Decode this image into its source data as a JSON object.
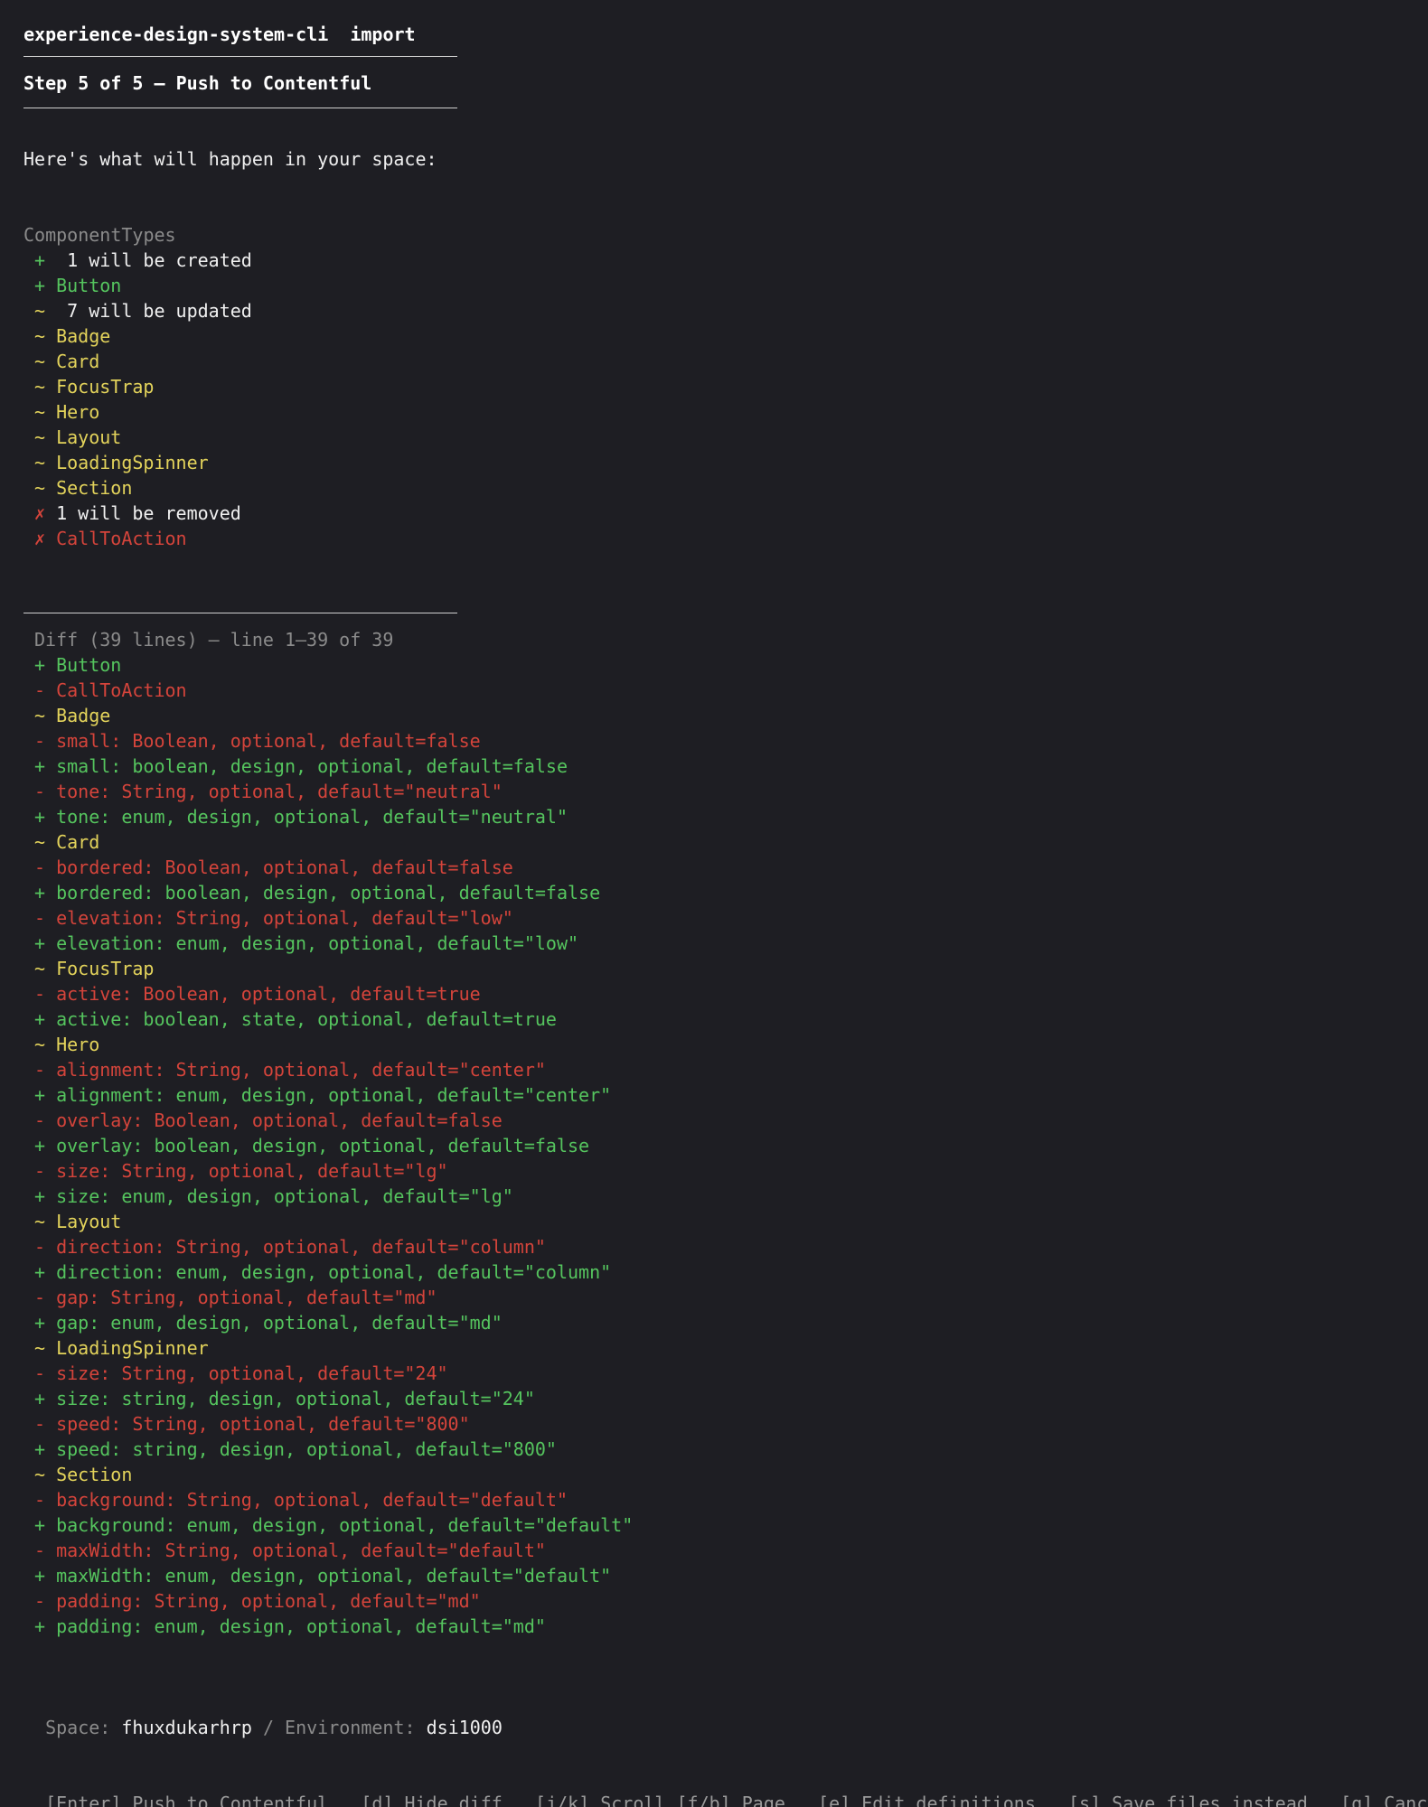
{
  "window": {
    "command": "experience-design-system-cli",
    "subcommand": "import"
  },
  "step": {
    "label": "Step 5 of 5 — Push to Contentful"
  },
  "intro": "Here's what will happen in your space:",
  "summary": {
    "heading": "ComponentTypes",
    "lines": [
      {
        "marker": "+",
        "text": " 1 will be created",
        "kind": "count-create"
      },
      {
        "marker": "+",
        "text": "Button",
        "kind": "create"
      },
      {
        "marker": "~",
        "text": " 7 will be updated",
        "kind": "count-update"
      },
      {
        "marker": "~",
        "text": "Badge",
        "kind": "update"
      },
      {
        "marker": "~",
        "text": "Card",
        "kind": "update"
      },
      {
        "marker": "~",
        "text": "FocusTrap",
        "kind": "update"
      },
      {
        "marker": "~",
        "text": "Hero",
        "kind": "update"
      },
      {
        "marker": "~",
        "text": "Layout",
        "kind": "update"
      },
      {
        "marker": "~",
        "text": "LoadingSpinner",
        "kind": "update"
      },
      {
        "marker": "~",
        "text": "Section",
        "kind": "update"
      },
      {
        "marker": "✗",
        "text": "1 will be removed",
        "kind": "count-remove"
      },
      {
        "marker": "✗",
        "text": "CallToAction",
        "kind": "remove"
      }
    ]
  },
  "diff": {
    "header": "Diff (39 lines) — line 1–39 of 39",
    "lines": [
      {
        "type": "add",
        "text": "+ Button"
      },
      {
        "type": "del",
        "text": "- CallToAction"
      },
      {
        "type": "mod",
        "text": "~ Badge"
      },
      {
        "type": "del",
        "text": "- small: Boolean, optional, default=false"
      },
      {
        "type": "add",
        "text": "+ small: boolean, design, optional, default=false"
      },
      {
        "type": "del",
        "text": "- tone: String, optional, default=\"neutral\""
      },
      {
        "type": "add",
        "text": "+ tone: enum, design, optional, default=\"neutral\""
      },
      {
        "type": "mod",
        "text": "~ Card"
      },
      {
        "type": "del",
        "text": "- bordered: Boolean, optional, default=false"
      },
      {
        "type": "add",
        "text": "+ bordered: boolean, design, optional, default=false"
      },
      {
        "type": "del",
        "text": "- elevation: String, optional, default=\"low\""
      },
      {
        "type": "add",
        "text": "+ elevation: enum, design, optional, default=\"low\""
      },
      {
        "type": "mod",
        "text": "~ FocusTrap"
      },
      {
        "type": "del",
        "text": "- active: Boolean, optional, default=true"
      },
      {
        "type": "add",
        "text": "+ active: boolean, state, optional, default=true"
      },
      {
        "type": "mod",
        "text": "~ Hero"
      },
      {
        "type": "del",
        "text": "- alignment: String, optional, default=\"center\""
      },
      {
        "type": "add",
        "text": "+ alignment: enum, design, optional, default=\"center\""
      },
      {
        "type": "del",
        "text": "- overlay: Boolean, optional, default=false"
      },
      {
        "type": "add",
        "text": "+ overlay: boolean, design, optional, default=false"
      },
      {
        "type": "del",
        "text": "- size: String, optional, default=\"lg\""
      },
      {
        "type": "add",
        "text": "+ size: enum, design, optional, default=\"lg\""
      },
      {
        "type": "mod",
        "text": "~ Layout"
      },
      {
        "type": "del",
        "text": "- direction: String, optional, default=\"column\""
      },
      {
        "type": "add",
        "text": "+ direction: enum, design, optional, default=\"column\""
      },
      {
        "type": "del",
        "text": "- gap: String, optional, default=\"md\""
      },
      {
        "type": "add",
        "text": "+ gap: enum, design, optional, default=\"md\""
      },
      {
        "type": "mod",
        "text": "~ LoadingSpinner"
      },
      {
        "type": "del",
        "text": "- size: String, optional, default=\"24\""
      },
      {
        "type": "add",
        "text": "+ size: string, design, optional, default=\"24\""
      },
      {
        "type": "del",
        "text": "- speed: String, optional, default=\"800\""
      },
      {
        "type": "add",
        "text": "+ speed: string, design, optional, default=\"800\""
      },
      {
        "type": "mod",
        "text": "~ Section"
      },
      {
        "type": "del",
        "text": "- background: String, optional, default=\"default\""
      },
      {
        "type": "add",
        "text": "+ background: enum, design, optional, default=\"default\""
      },
      {
        "type": "del",
        "text": "- maxWidth: String, optional, default=\"default\""
      },
      {
        "type": "add",
        "text": "+ maxWidth: enum, design, optional, default=\"default\""
      },
      {
        "type": "del",
        "text": "- padding: String, optional, default=\"md\""
      },
      {
        "type": "add",
        "text": "+ padding: enum, design, optional, default=\"md\""
      }
    ]
  },
  "context": {
    "space_label": "Space:",
    "space_value": "fhuxdukarhrp",
    "separator": "/",
    "env_label": "Environment:",
    "env_value": "dsi1000"
  },
  "keys": [
    "[Enter] Push to Contentful",
    "[d] Hide diff",
    "[j/k] Scroll [f/b] Page",
    "[e] Edit definitions",
    "[s] Save files instead",
    "[q] Cancel"
  ],
  "colors": {
    "background": "#1e1e23",
    "add": "#55c45e",
    "update": "#e3d35b",
    "remove": "#d4443b",
    "muted": "#8b8b8b",
    "text": "#f0f0f0"
  }
}
